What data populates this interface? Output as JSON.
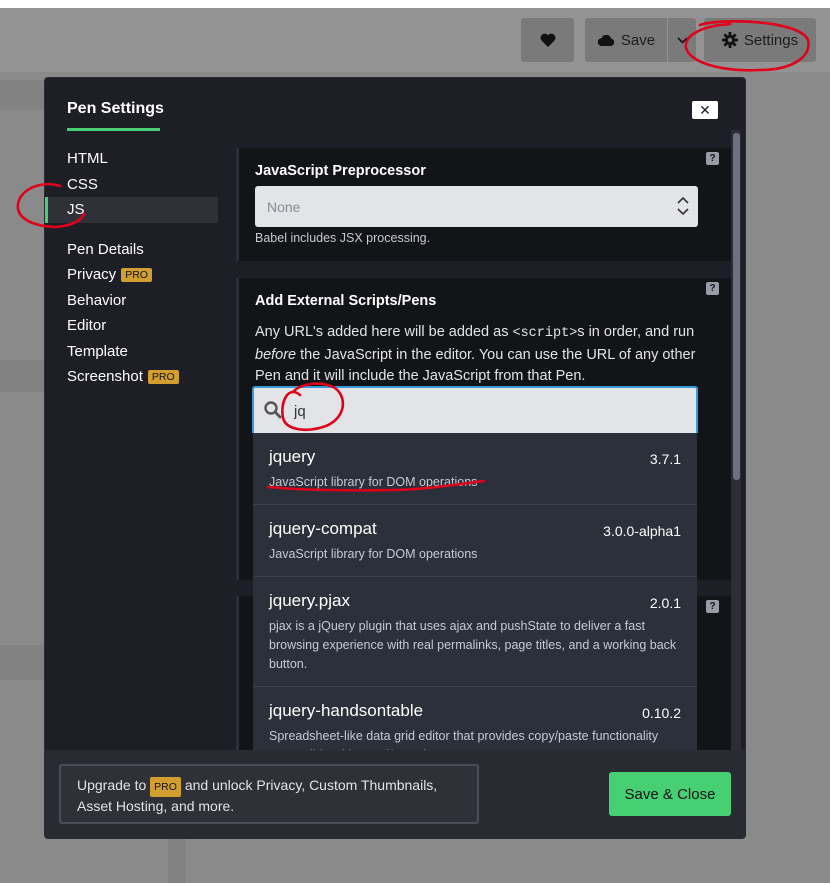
{
  "header": {
    "save_label": "Save",
    "settings_label": "Settings"
  },
  "modal": {
    "title": "Pen Settings",
    "close_label": "✕"
  },
  "nav": {
    "items": [
      {
        "label": "HTML"
      },
      {
        "label": "CSS"
      },
      {
        "label": "JS",
        "active": true
      },
      {
        "label": "Pen Details"
      },
      {
        "label": "Privacy",
        "badge": "PRO"
      },
      {
        "label": "Behavior"
      },
      {
        "label": "Editor"
      },
      {
        "label": "Template"
      },
      {
        "label": "Screenshot",
        "badge": "PRO"
      }
    ]
  },
  "js_preprocessor": {
    "heading": "JavaScript Preprocessor",
    "help": "?",
    "selected": "None",
    "note": "Babel includes JSX processing."
  },
  "external_scripts": {
    "heading": "Add External Scripts/Pens",
    "help": "?",
    "desc_part1": "Any URL's added here will be added as ",
    "desc_code": "<script>",
    "desc_part2": "s in order, and run ",
    "desc_em": "before",
    "desc_part3": " the JavaScript in the editor. You can use the URL of any other Pen and it will include the JavaScript from that Pen.",
    "search_value": "jq",
    "results": [
      {
        "name": "jquery",
        "version": "3.7.1",
        "desc": "JavaScript library for DOM operations"
      },
      {
        "name": "jquery-compat",
        "version": "3.0.0-alpha1",
        "desc": "JavaScript library for DOM operations"
      },
      {
        "name": "jquery.pjax",
        "version": "2.0.1",
        "desc": "pjax is a jQuery plugin that uses ajax and pushState to deliver a fast browsing experience with real permalinks, page titles, and a working back button."
      },
      {
        "name": "jquery-handsontable",
        "version": "0.10.2",
        "desc": "Spreadsheet-like data grid editor that provides copy/paste functionality compatible with Excel/Google Docs"
      }
    ]
  },
  "third_help": "?",
  "footer": {
    "upgrade_pre": "Upgrade to ",
    "upgrade_badge": "PRO",
    "upgrade_post": " and unlock Privacy, Custom Thumbnails, Asset Hosting, and more.",
    "save_close_label": "Save & Close"
  },
  "colors": {
    "accent_green": "#47cf73",
    "pro_badge": "#d19e2f",
    "focus_blue": "#3a9ad9",
    "annotation_red": "#e0001a"
  }
}
